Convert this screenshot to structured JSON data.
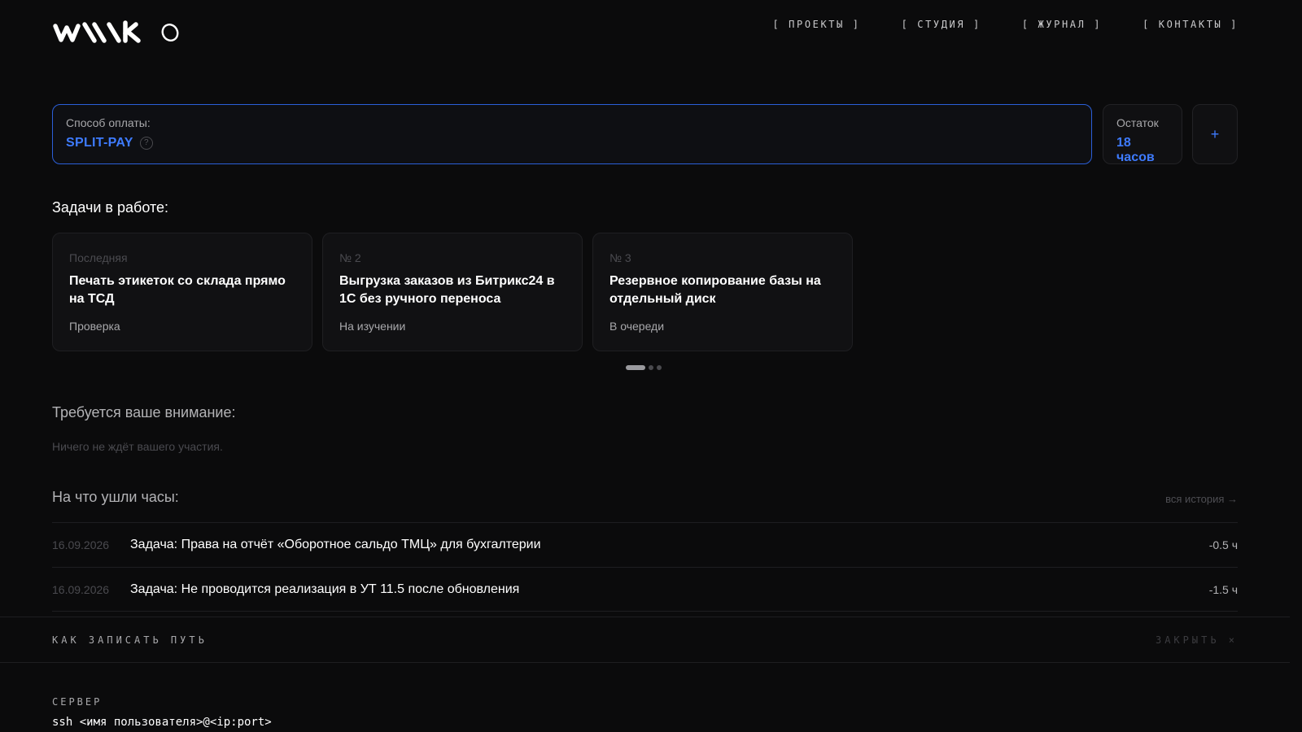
{
  "header": {
    "logo_text": "WALLKO",
    "nav": [
      "[ ПРОЕКТЫ ]",
      "[ СТУДИЯ ]",
      "[ ЖУРНАЛ ]",
      "[ КОНТАКТЫ ]"
    ]
  },
  "payment": {
    "label": "Способ оплаты:",
    "value": "SPLIT-PAY",
    "help_icon": "?",
    "rest_label": "Остаток",
    "rest_value": "18 часов",
    "add_label": "+"
  },
  "tasks": {
    "title": "Задачи в работе:",
    "items": [
      {
        "tag": "Последняя",
        "title": "Печать этикеток со склада прямо на ТСД",
        "status": "Проверка"
      },
      {
        "tag": "№ 2",
        "title": "Выгрузка заказов из Битрикс24 в 1С без ручного переноса",
        "status": "На изучении"
      },
      {
        "tag": "№ 3",
        "title": "Резервное копирование базы на отдельный диск",
        "status": "В очереди"
      }
    ]
  },
  "attention": {
    "title": "Требуется ваше внимание:",
    "empty": "Ничего не ждёт вашего участия."
  },
  "hours": {
    "title": "На что ушли часы:",
    "history_link": "вся история →",
    "rows": [
      {
        "date": "16.09.2026",
        "desc": "Задача: Права на отчёт «Оборотное сальдо ТМЦ» для бухгалтерии",
        "amount": "-0.5 ч"
      },
      {
        "date": "16.09.2026",
        "desc": "Задача: Не проводится реализация в УТ 11.5 после обновления",
        "amount": "-1.5 ч"
      }
    ]
  },
  "path_panel": {
    "title": "КАК ЗАПИСАТЬ ПУТЬ",
    "close": "ЗАКРЫТЬ ×",
    "server_label": "СЕРВЕР",
    "server_cmd": "ssh <имя пользователя>@<ip:port>"
  },
  "colors": {
    "accent": "#3e7bff",
    "background": "#0b0b0c",
    "border_active": "#2b5fd9"
  }
}
